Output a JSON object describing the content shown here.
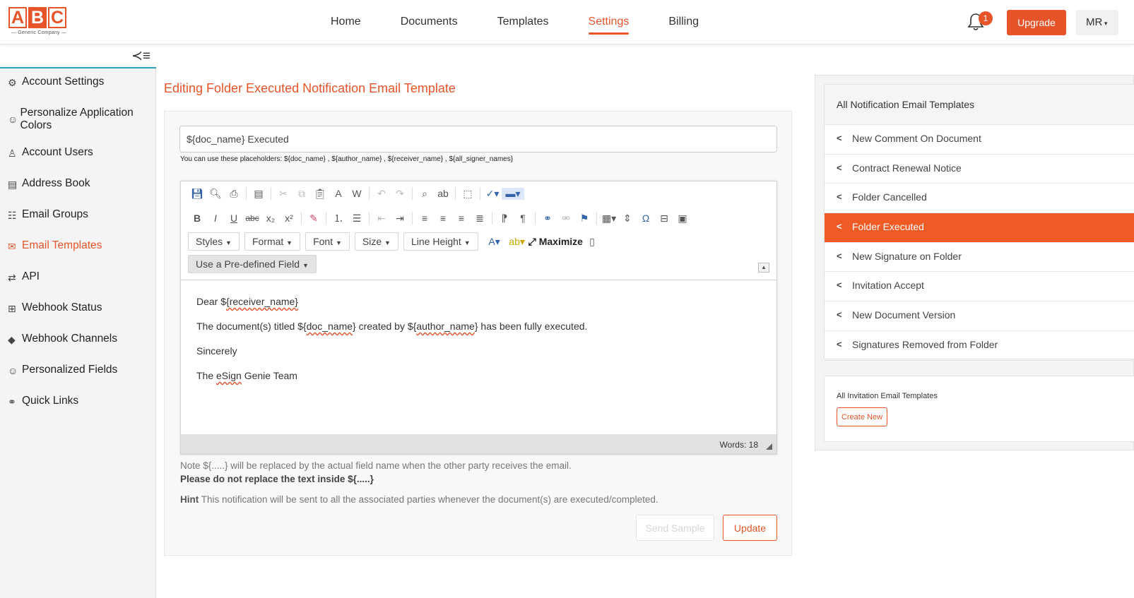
{
  "logo": {
    "letters": [
      "A",
      "B",
      "C"
    ],
    "subtitle": "— Generic Company —"
  },
  "nav": {
    "items": [
      "Home",
      "Documents",
      "Templates",
      "Settings",
      "Billing"
    ],
    "active": "Settings"
  },
  "header": {
    "notification_count": "1",
    "upgrade_label": "Upgrade",
    "user_initials": "MR",
    "accent_color": "#e8542a"
  },
  "sidebar": {
    "toggle_icon": "≺≡",
    "items": [
      {
        "label": "Account Settings",
        "icon": "user-gear-icon",
        "glyph": "⚙"
      },
      {
        "label": "Personalize Application Colors",
        "icon": "palette-icon",
        "glyph": "☺"
      },
      {
        "label": "Account Users",
        "icon": "user-check-icon",
        "glyph": "♙"
      },
      {
        "label": "Address Book",
        "icon": "address-book-icon",
        "glyph": "▤"
      },
      {
        "label": "Email Groups",
        "icon": "group-icon",
        "glyph": "☷"
      },
      {
        "label": "Email Templates",
        "icon": "email-template-icon",
        "glyph": "✉"
      },
      {
        "label": "API",
        "icon": "exchange-icon",
        "glyph": "⇄"
      },
      {
        "label": "Webhook Status",
        "icon": "sitemap-icon",
        "glyph": "⊞"
      },
      {
        "label": "Webhook Channels",
        "icon": "diamond-icon",
        "glyph": "◆"
      },
      {
        "label": "Personalized Fields",
        "icon": "smile-icon",
        "glyph": "☺"
      },
      {
        "label": "Quick Links",
        "icon": "link-icon",
        "glyph": "⚭"
      }
    ]
  },
  "main": {
    "title": "Editing Folder Executed Notification Email Template",
    "subject_value": "${doc_name} Executed",
    "placeholders_text": "You can use these placeholders:  ${doc_name} ,  ${author_name} ,  ${receiver_name}  ,  ${all_signer_names}",
    "toolbar": {
      "combos": [
        "Styles",
        "Format",
        "Font",
        "Size",
        "Line Height"
      ],
      "maximize_label": "Maximize",
      "predefined_field_label": "Use a Pre-defined Field"
    },
    "body": {
      "line1_pre": "Dear $",
      "line1_var": "{receiver_name}",
      "line2_a": "The document(s) titled ${",
      "line2_var1": "doc_name",
      "line2_b": "} created by ${",
      "line2_var2": "author_name",
      "line2_c": "} has been fully executed.",
      "line3": "Sincerely",
      "line4_pre": "The ",
      "line4_var": "eSign",
      "line4_post": " Genie Team"
    },
    "word_count": "Words: 18",
    "note_line1": "Note ${.....} will be replaced by the actual field name when the other party receives the email.",
    "note_line2": "Please do not replace the text inside ${.....}",
    "hint_label": "Hint",
    "hint_text": " This notification will be sent to all the associated parties whenever the document(s) are executed/completed.",
    "send_sample_label": "Send Sample",
    "update_label": "Update"
  },
  "right_panel": {
    "templates_title": "All Notification Email Templates",
    "templates": [
      "New Comment On Document",
      "Contract Renewal Notice",
      "Folder Cancelled",
      "Folder Executed",
      "New Signature on Folder",
      "Invitation Accept",
      "New Document Version",
      "Signatures Removed from Folder"
    ],
    "active_template": "Folder Executed",
    "invitation_title": "All Invitation Email Templates",
    "create_new_label": "Create New"
  }
}
